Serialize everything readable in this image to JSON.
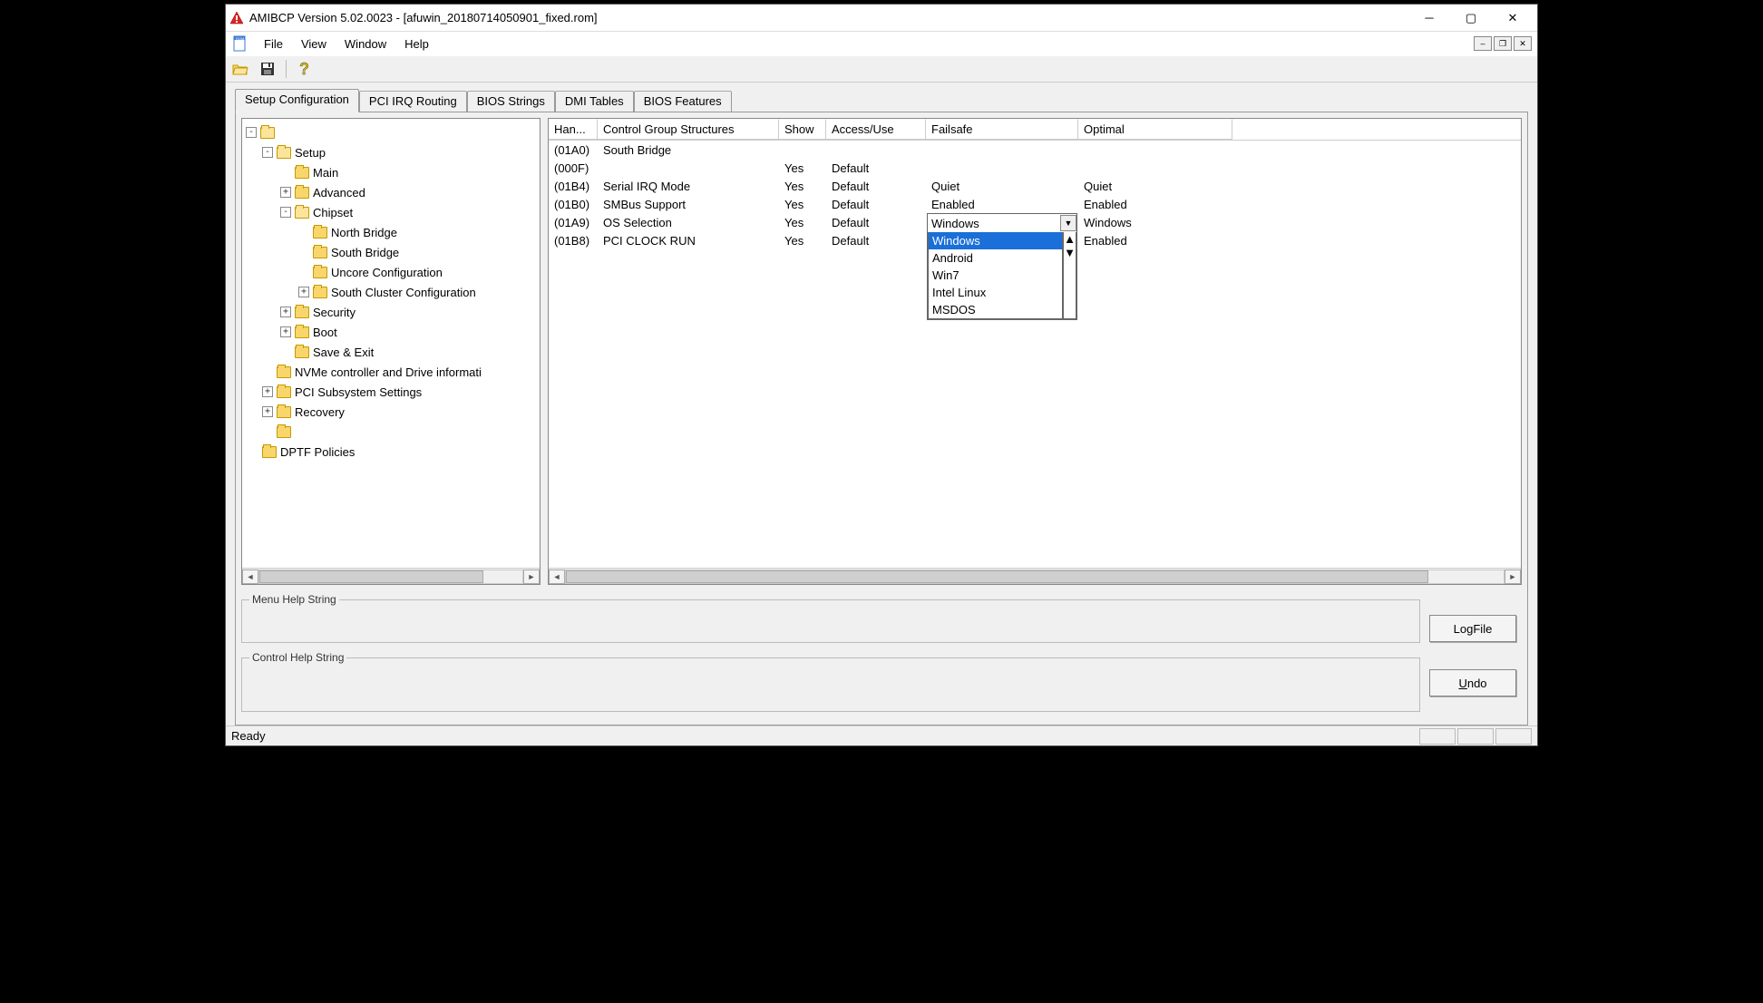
{
  "window": {
    "title": "AMIBCP Version 5.02.0023 - [afuwin_20180714050901_fixed.rom]"
  },
  "menus": [
    "File",
    "View",
    "Window",
    "Help"
  ],
  "tabs": [
    "Setup Configuration",
    "PCI IRQ Routing",
    "BIOS Strings",
    "DMI Tables",
    "BIOS Features"
  ],
  "tree": {
    "Setup": "Setup",
    "Main": "Main",
    "Advanced": "Advanced",
    "Chipset": "Chipset",
    "NorthBridge": "North Bridge",
    "SouthBridge": "South Bridge",
    "Uncore": "Uncore Configuration",
    "SouthCluster": "South Cluster Configuration",
    "Security": "Security",
    "Boot": "Boot",
    "SaveExit": "Save & Exit",
    "NVMe": "NVMe controller and Drive informati",
    "PCISub": "PCI Subsystem Settings",
    "Recovery": "Recovery",
    "DPTF": "DPTF Policies"
  },
  "columns": {
    "han": "Han...",
    "cgs": "Control Group Structures",
    "show": "Show",
    "access": "Access/Use",
    "fail": "Failsafe",
    "opt": "Optimal"
  },
  "rows": [
    {
      "han": "(01A0)",
      "cgs": "South Bridge",
      "show": "",
      "access": "",
      "fail": "",
      "opt": ""
    },
    {
      "han": "(000F)",
      "cgs": "",
      "show": "Yes",
      "access": "Default",
      "fail": "",
      "opt": ""
    },
    {
      "han": "(01B4)",
      "cgs": "Serial IRQ Mode",
      "show": "Yes",
      "access": "Default",
      "fail": "Quiet",
      "opt": "Quiet"
    },
    {
      "han": "(01B0)",
      "cgs": "SMBus Support",
      "show": "Yes",
      "access": "Default",
      "fail": "Enabled",
      "opt": "Enabled"
    },
    {
      "han": "(01A9)",
      "cgs": "OS Selection",
      "show": "Yes",
      "access": "Default",
      "fail": "Windows",
      "opt": "Windows"
    },
    {
      "han": "(01B8)",
      "cgs": "PCI CLOCK RUN",
      "show": "Yes",
      "access": "Default",
      "fail": "",
      "opt": "Enabled"
    }
  ],
  "dropdown": {
    "value": "Windows",
    "options": [
      "Windows",
      "Android",
      "Win7",
      "Intel Linux",
      "MSDOS"
    ]
  },
  "groups": {
    "menuHelp": "Menu Help String",
    "ctrlHelp": "Control Help String"
  },
  "buttons": {
    "logfile": "LogFile",
    "undo": "Undo"
  },
  "status": "Ready"
}
